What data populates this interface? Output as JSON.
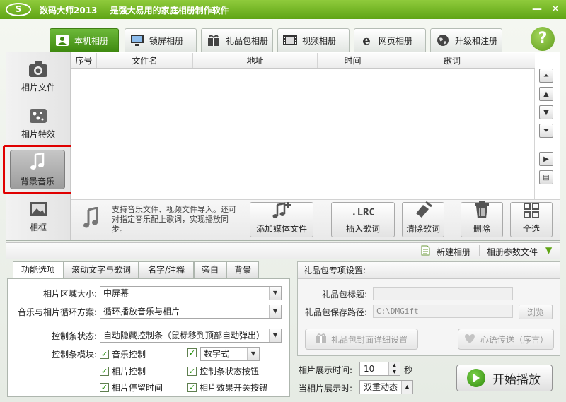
{
  "window": {
    "logo_text": "S",
    "app_title": "数码大师2013",
    "app_slogan": "是强大易用的家庭相册制作软件",
    "minimize": "—",
    "close": "✕"
  },
  "tabs": [
    {
      "label": "本机相册",
      "icon": "photo-album-icon"
    },
    {
      "label": "锁屏相册",
      "icon": "monitor-icon"
    },
    {
      "label": "礼品包相册",
      "icon": "gift-icon"
    },
    {
      "label": "视频相册",
      "icon": "film-icon"
    },
    {
      "label": "网页相册",
      "icon": "ie-icon"
    },
    {
      "label": "升级和注册",
      "icon": "globe-icon"
    }
  ],
  "help_label": "?",
  "sidebar": {
    "items": [
      {
        "label": "相片文件",
        "icon": "camera-icon"
      },
      {
        "label": "相片特效",
        "icon": "effects-icon"
      },
      {
        "label": "背景音乐",
        "icon": "music-note-icon"
      },
      {
        "label": "相框",
        "icon": "frame-icon"
      }
    ]
  },
  "grid": {
    "columns": [
      "序号",
      "文件名",
      "地址",
      "时间",
      "歌词"
    ],
    "rows": []
  },
  "toolbar": {
    "tip": "支持音乐文件、视频文件导入。还可对指定音乐配上歌词，实现播放同步。",
    "buttons": [
      "添加媒体文件",
      "插入歌词",
      "清除歌词",
      "删除",
      "全选"
    ],
    "lrc_text": ".LRC"
  },
  "strip": {
    "new_album": "新建相册",
    "album_params": "相册参数文件"
  },
  "lower_tabs": [
    "功能选项",
    "滚动文字与歌词",
    "名字/注释",
    "旁白",
    "背景"
  ],
  "options": {
    "area_size_label": "相片区域大小:",
    "area_size_value": "中屏幕",
    "loop_label": "音乐与相片循环方案:",
    "loop_value": "循环播放音乐与相片",
    "control_state_label": "控制条状态:",
    "control_state_value": "自动隐藏控制条（鼠标移到顶部自动弹出）",
    "control_module_label": "控制条模块:",
    "checks": [
      {
        "label": "音乐控制",
        "checked": true
      },
      {
        "label": "数字式",
        "checked": true,
        "is_select": true
      },
      {
        "label": "相片控制",
        "checked": true
      },
      {
        "label": "控制条状态按钮",
        "checked": true
      },
      {
        "label": "相片停留时间",
        "checked": true
      },
      {
        "label": "相片效果开关按钮",
        "checked": true
      }
    ]
  },
  "gift": {
    "title": "礼品包专项设置:",
    "gift_title_label": "礼品包标题:",
    "gift_title_value": "",
    "save_path_label": "礼品包保存路径:",
    "save_path_value": "C:\\DMGift",
    "browse": "浏览",
    "cover_button": "礼品包封面详细设置",
    "message_button": "心语传送（序言）"
  },
  "display": {
    "time_label": "相片展示时间:",
    "time_value": "10",
    "time_unit": "秒",
    "mode_label": "当相片展示时:",
    "mode_value": "双重动态"
  },
  "play_button": "开始播放"
}
